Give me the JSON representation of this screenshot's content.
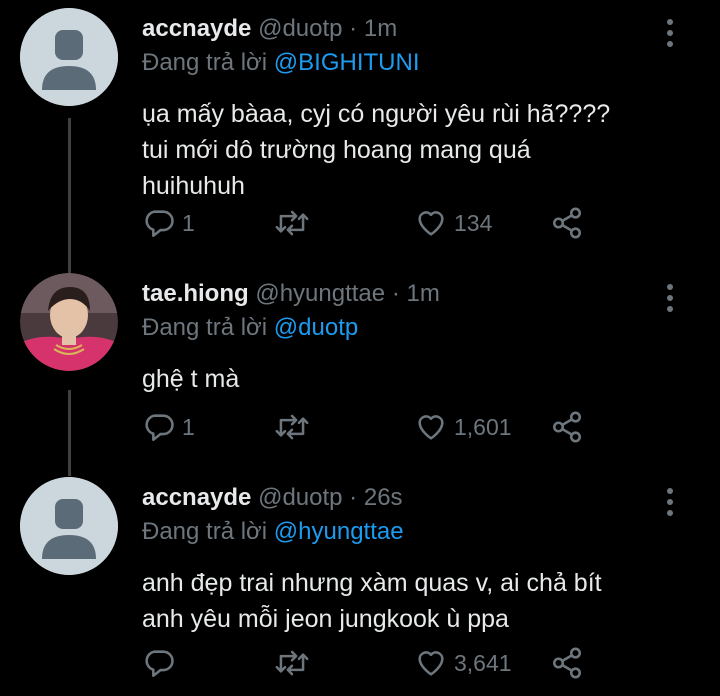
{
  "tweets": [
    {
      "name": "accnayde",
      "handle": "@duotp",
      "separator": "·",
      "time": "1m",
      "reply_prefix": "Đang trả lời ",
      "reply_to": "@BIGHITUNI",
      "text_lines": [
        "ụa mấy bàaa, cyj có người yêu rùi hã????",
        "tui mới dô trường hoang mang quá",
        "huihuhuh"
      ],
      "avatar": "default-avatar",
      "replies": "1",
      "retweets": "",
      "likes": "134"
    },
    {
      "name": "tae.hiong",
      "handle": "@hyungttae",
      "separator": "·",
      "time": "1m",
      "reply_prefix": "Đang trả lời ",
      "reply_to": "@duotp",
      "text_lines": [
        "ghệ t mà"
      ],
      "avatar": "profile-photo",
      "replies": "1",
      "retweets": "",
      "likes": "1,601"
    },
    {
      "name": "accnayde",
      "handle": "@duotp",
      "separator": "·",
      "time": "26s",
      "reply_prefix": "Đang trả lời ",
      "reply_to": "@hyungttae",
      "text_lines": [
        "anh đẹp trai nhưng xàm quas v, ai chả bít",
        "anh yêu mỗi jeon jungkook ù ppa"
      ],
      "avatar": "default-avatar",
      "replies": "",
      "retweets": "",
      "likes": "3,641"
    }
  ],
  "icons": {
    "reply": "reply-icon",
    "retweet": "retweet-icon",
    "like": "heart-icon",
    "share": "share-icon",
    "more": "more-vertical-icon"
  },
  "colors": {
    "background": "#000000",
    "text": "#e7e9ea",
    "muted": "#6e767d",
    "mention": "#1d9bf0",
    "thread_line": "#3e4144",
    "avatar_default": "#ccd6dd"
  }
}
